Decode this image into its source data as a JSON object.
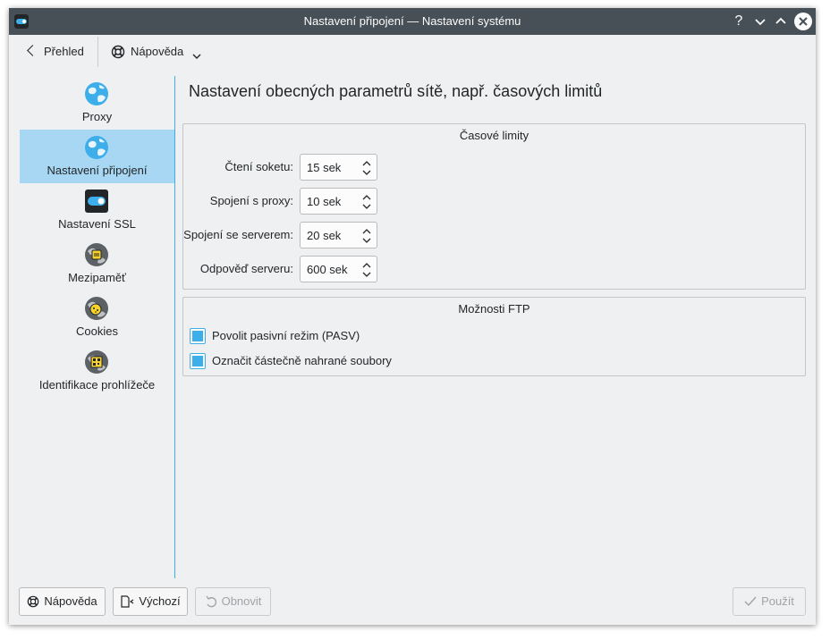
{
  "window": {
    "title": "Nastavení připojení  — Nastavení systému"
  },
  "titlebar_buttons": [
    "help-icon",
    "minimize-icon",
    "maximize-icon",
    "close-icon"
  ],
  "toolbar": {
    "back_label": "Přehled",
    "help_label": "Nápověda"
  },
  "sidebar": {
    "items": [
      {
        "label": "Proxy",
        "icon": "globe-icon",
        "active": false
      },
      {
        "label": "Nastavení připojení",
        "icon": "globe-icon",
        "active": true
      },
      {
        "label": "Nastavení SSL",
        "icon": "toggle-icon",
        "active": false
      },
      {
        "label": "Mezipaměť",
        "icon": "cache-icon",
        "active": false
      },
      {
        "label": "Cookies",
        "icon": "cookie-icon",
        "active": false
      },
      {
        "label": "Identifikace prohlížeče",
        "icon": "browser-id-icon",
        "active": false
      }
    ]
  },
  "main": {
    "title": "Nastavení obecných parametrů sítě, např. časových limitů",
    "timeouts": {
      "title": "Časové limity",
      "rows": [
        {
          "label": "Čtení soketu:",
          "value": "15 sek"
        },
        {
          "label": "Spojení s proxy:",
          "value": "10 sek"
        },
        {
          "label": "Spojení se serverem:",
          "value": "20 sek"
        },
        {
          "label": "Odpověď serveru:",
          "value": "600 sek"
        }
      ]
    },
    "ftp": {
      "title": "Možnosti FTP",
      "options": [
        {
          "label": "Povolit pasivní režim (PASV)",
          "checked": true
        },
        {
          "label": "Označit částečně nahrané soubory",
          "checked": true
        }
      ]
    }
  },
  "buttons": {
    "help": "Nápověda",
    "defaults": "Výchozí",
    "reset": "Obnovit",
    "apply": "Použít"
  },
  "colors": {
    "accent": "#3daee9",
    "titlebar": "#475057",
    "selection": "#a7d7f3"
  }
}
